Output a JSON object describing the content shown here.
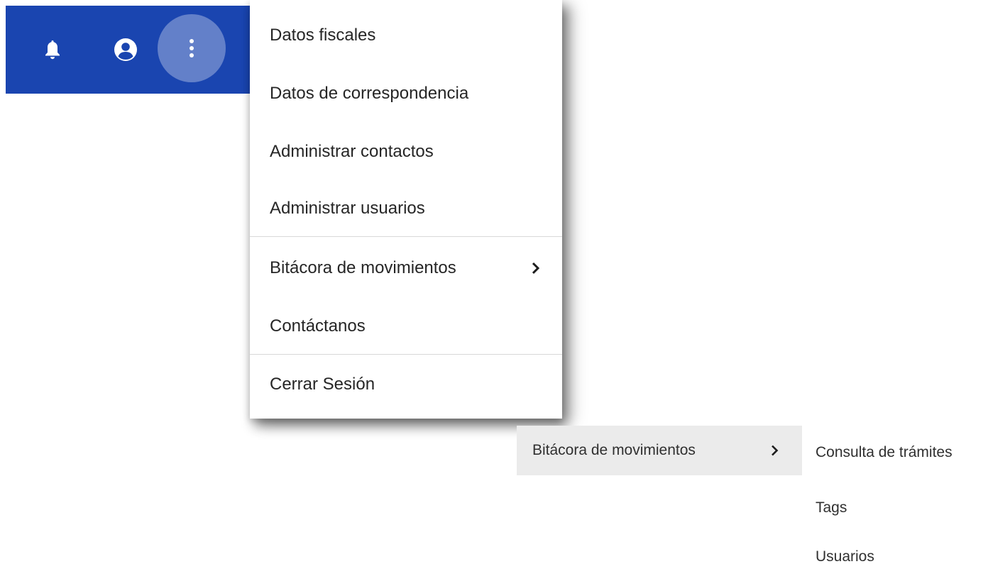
{
  "toolbar": {
    "background": "#1a45b0",
    "icons": [
      {
        "name": "bell-icon"
      },
      {
        "name": "account-circle-icon"
      },
      {
        "name": "more-vert-icon"
      }
    ]
  },
  "menu": {
    "items": [
      {
        "label": "Datos fiscales"
      },
      {
        "label": "Datos de correspondencia"
      },
      {
        "label": "Administrar contactos"
      },
      {
        "label": "Administrar usuarios"
      },
      {
        "label": "Bitácora de movimientos",
        "has_submenu": true,
        "chevron_icon": "chevron-right-icon"
      },
      {
        "label": "Contáctanos"
      },
      {
        "label": "Cerrar Sesión"
      }
    ]
  },
  "submenu": {
    "trigger_label": "Bitácora de movimientos",
    "trigger_highlight": "#ebebeb",
    "items": [
      {
        "label": "Consulta de trámites"
      },
      {
        "label": "Tags"
      },
      {
        "label": "Usuarios"
      }
    ]
  }
}
